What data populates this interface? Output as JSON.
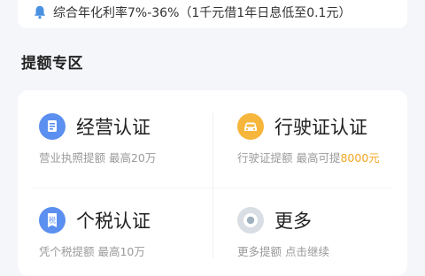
{
  "notice": {
    "icon": "bell-icon",
    "text": "综合年化利率7%-36%（1千元借1年日息低至0.1元）"
  },
  "section": {
    "title": "提额专区"
  },
  "items": [
    {
      "icon": "document-icon",
      "icon_color": "#5b8ff0",
      "title": "经营认证",
      "subtitle": "营业执照提额 最高20万",
      "subtitle_highlight": ""
    },
    {
      "icon": "car-icon",
      "icon_color": "#f6b63b",
      "title": "行驶证认证",
      "subtitle": "行驶证提额 最高可提",
      "subtitle_highlight": "8000元"
    },
    {
      "icon": "tax-icon",
      "icon_color": "#5b8ff0",
      "title": "个税认证",
      "subtitle": "凭个税提额 最高10万",
      "subtitle_highlight": ""
    },
    {
      "icon": "more-icon",
      "icon_color": "#d9dee5",
      "title": "更多",
      "subtitle": "更多提额 点击继续",
      "subtitle_highlight": ""
    }
  ]
}
